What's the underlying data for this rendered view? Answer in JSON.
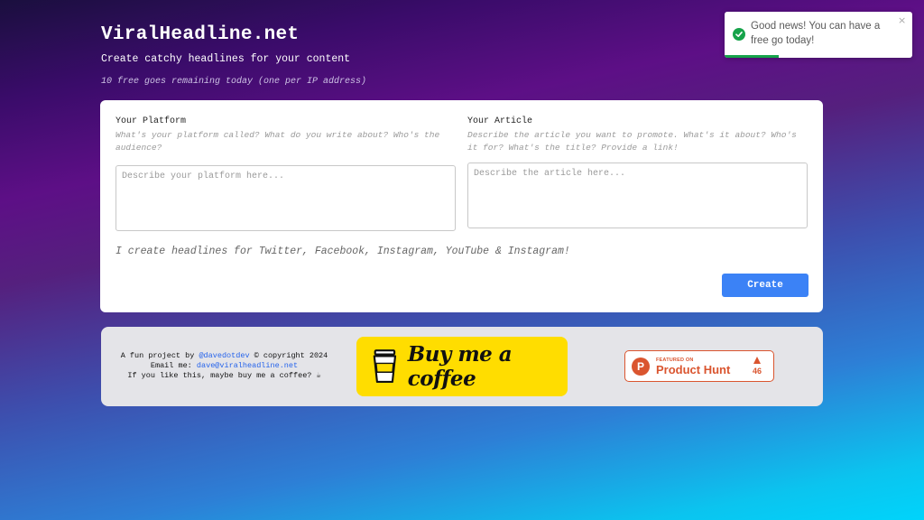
{
  "header": {
    "title": "ViralHeadline.net",
    "tagline": "Create catchy headlines for your content",
    "remaining": "10 free goes remaining today (one per IP address)"
  },
  "form": {
    "platform": {
      "label": "Your Platform",
      "description": "What's your platform called? What do you write about? Who's the audience?",
      "placeholder": "Describe your platform here...",
      "value": ""
    },
    "article": {
      "label": "Your Article",
      "description": "Describe the article you want to promote. What's it about? Who's it for? What's the title? Provide a link!",
      "placeholder": "Describe the article here...",
      "value": ""
    },
    "platforms_note": "I create headlines for Twitter, Facebook, Instagram, YouTube & Instagram!",
    "create_label": "Create"
  },
  "footer": {
    "line1_prefix": "A fun project by ",
    "author_link": "@davedotdev",
    "line1_suffix": " © copyright 2024",
    "email_prefix": "Email me:  ",
    "email_link": "dave@viralheadline.net",
    "line3": "If you like this, maybe buy me a coffee? ☕",
    "coffee_label": "Buy me a coffee",
    "product_hunt": {
      "featured_label": "FEATURED ON",
      "name": "Product Hunt",
      "votes": "46",
      "logo_letter": "P"
    }
  },
  "toast": {
    "message": "Good news! You can have a free go today!",
    "close": "×",
    "progress": 0.29
  },
  "colors": {
    "accent": "#3b82f6",
    "success": "#16a34a",
    "coffee": "#ffdd00",
    "product_hunt": "#da552f"
  }
}
